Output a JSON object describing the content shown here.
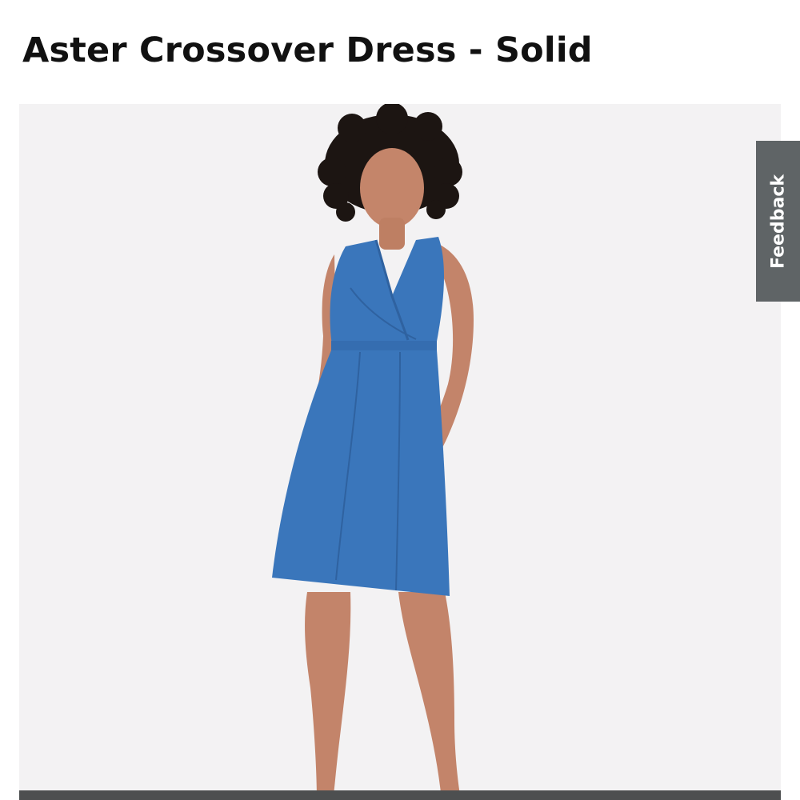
{
  "product": {
    "title": "Aster Crossover Dress - Solid",
    "image_subject": "model-in-blue-sleeveless-crossover-dress"
  },
  "feedback": {
    "label": "Feedback"
  },
  "colors": {
    "dress": "#3a76bb",
    "image_background": "#f3f2f3",
    "feedback_tab": "#5f6466",
    "bottom_bar": "#4d4f50"
  }
}
